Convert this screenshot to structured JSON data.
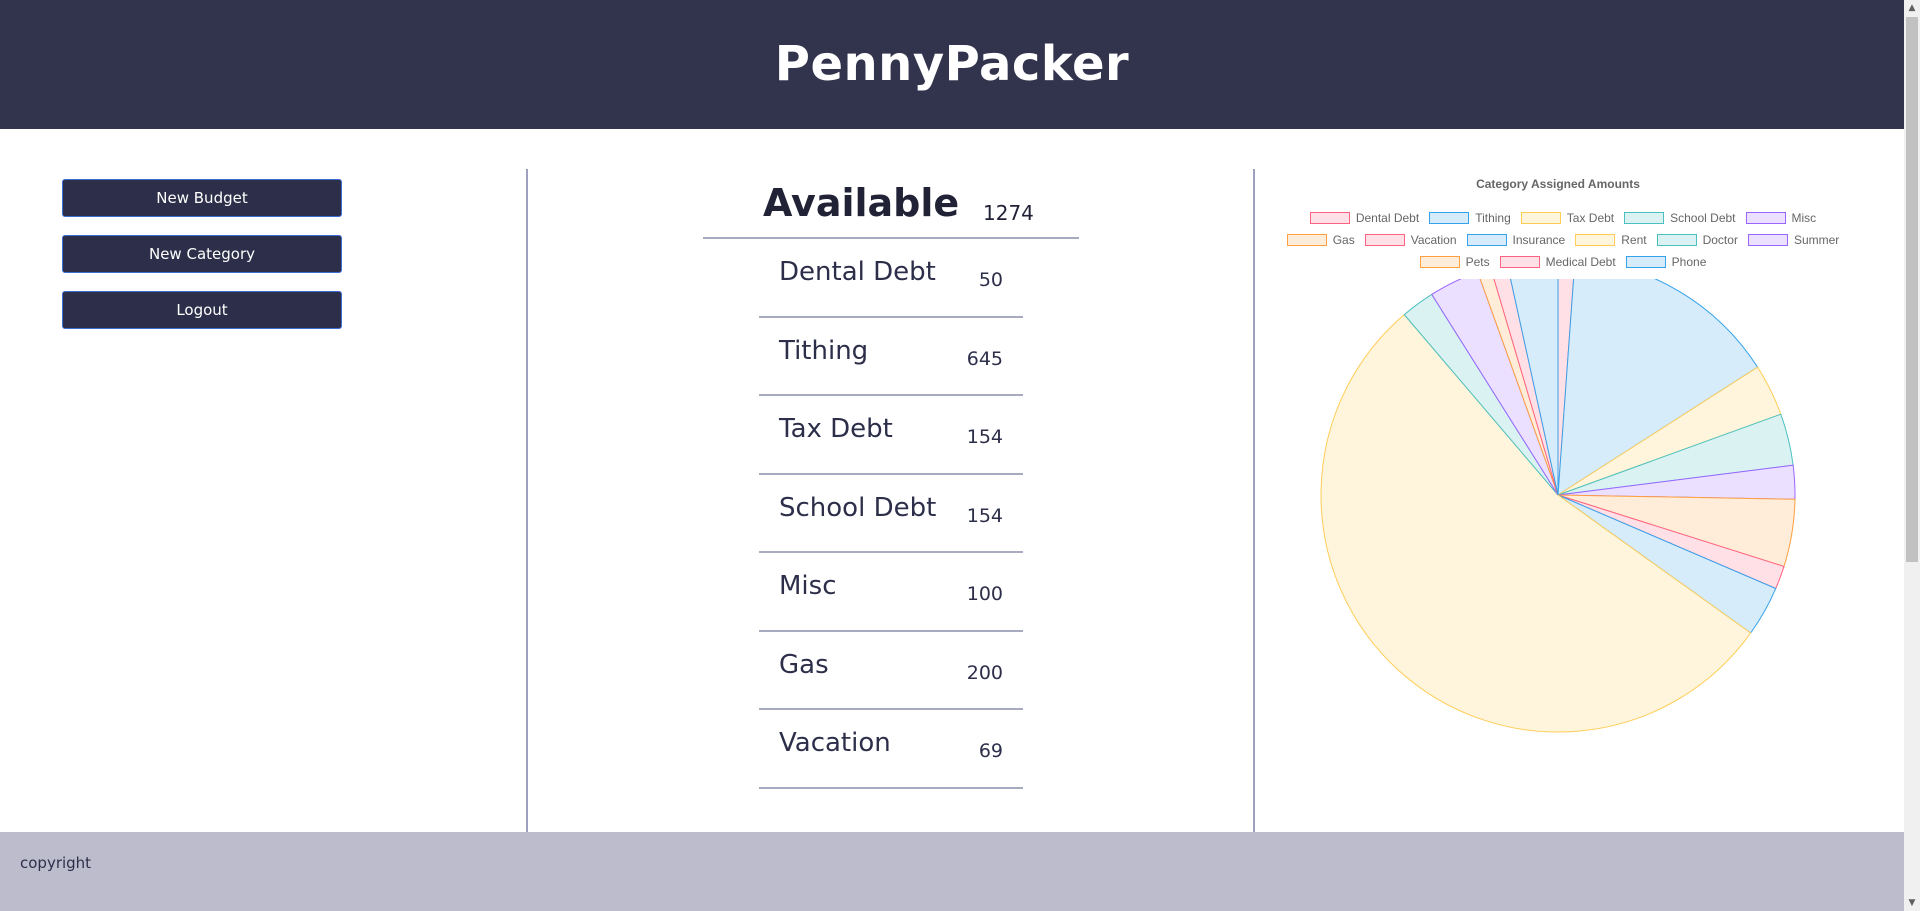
{
  "app": {
    "title": "PennyPacker"
  },
  "sidebar": {
    "buttons": [
      {
        "label": "New Budget"
      },
      {
        "label": "New Category"
      },
      {
        "label": "Logout"
      }
    ]
  },
  "budget": {
    "available_label": "Available",
    "available_value": "1274",
    "categories": [
      {
        "name": "Dental Debt",
        "value": "50"
      },
      {
        "name": "Tithing",
        "value": "645"
      },
      {
        "name": "Tax Debt",
        "value": "154"
      },
      {
        "name": "School Debt",
        "value": "154"
      },
      {
        "name": "Misc",
        "value": "100"
      },
      {
        "name": "Gas",
        "value": "200"
      },
      {
        "name": "Vacation",
        "value": "69"
      }
    ]
  },
  "chart_data": {
    "type": "pie",
    "title": "Category Assigned Amounts",
    "legend_position": "top",
    "categories": [
      "Dental Debt",
      "Tithing",
      "Tax Debt",
      "School Debt",
      "Misc",
      "Gas",
      "Vacation",
      "Insurance",
      "Rent",
      "Doctor",
      "Summer",
      "Pets",
      "Medical Debt",
      "Phone"
    ],
    "values": [
      50,
      645,
      154,
      154,
      100,
      200,
      69,
      150,
      2350,
      100,
      150,
      40,
      50,
      150
    ],
    "colors": [
      {
        "fill": "#ffe0e6",
        "border": "#ff6384"
      },
      {
        "fill": "#d7ecfb",
        "border": "#36a2eb"
      },
      {
        "fill": "#fff5dd",
        "border": "#ffcd56"
      },
      {
        "fill": "#dbf2f2",
        "border": "#4bc0c0"
      },
      {
        "fill": "#ebe0ff",
        "border": "#9966ff"
      },
      {
        "fill": "#ffecd9",
        "border": "#ff9f40"
      },
      {
        "fill": "#ffe0e6",
        "border": "#ff6384"
      },
      {
        "fill": "#d7ecfb",
        "border": "#36a2eb"
      },
      {
        "fill": "#fff5dd",
        "border": "#ffcd56"
      },
      {
        "fill": "#dbf2f2",
        "border": "#4bc0c0"
      },
      {
        "fill": "#ebe0ff",
        "border": "#9966ff"
      },
      {
        "fill": "#ffecd9",
        "border": "#ff9f40"
      },
      {
        "fill": "#ffe0e6",
        "border": "#ff6384"
      },
      {
        "fill": "#d7ecfb",
        "border": "#36a2eb"
      }
    ]
  },
  "footer": {
    "text": "copyright"
  },
  "icons": {
    "scroll_up": "▲",
    "scroll_down": "▼"
  }
}
